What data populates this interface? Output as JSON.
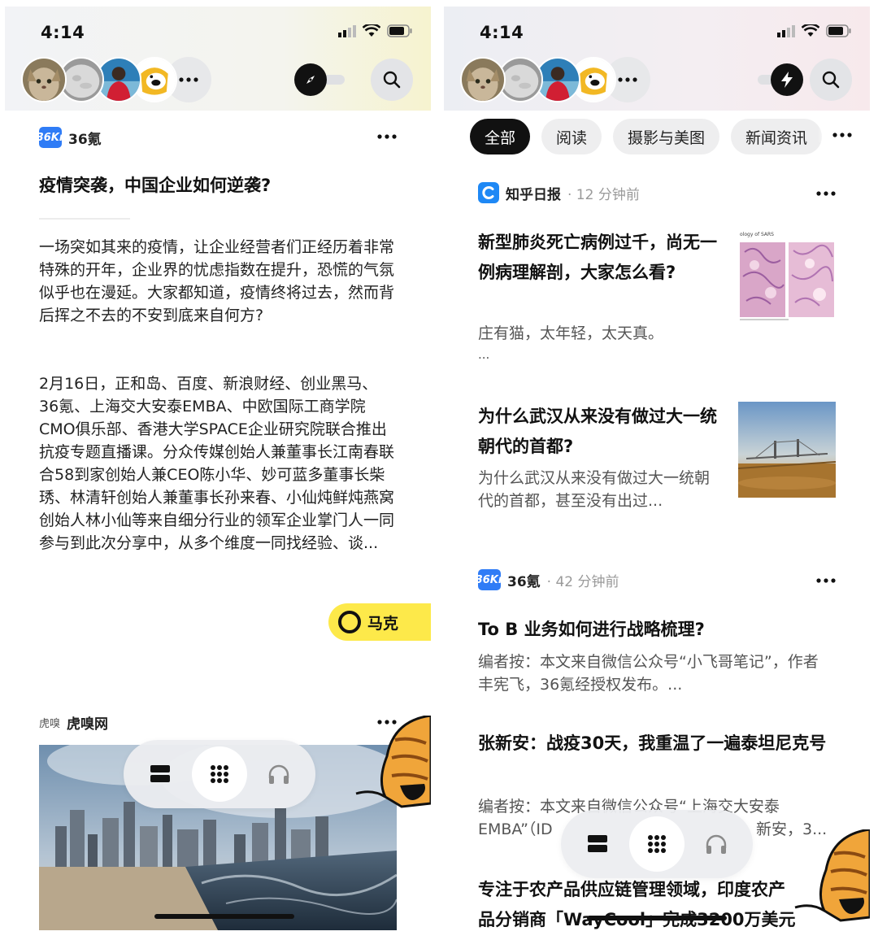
{
  "status_bar": {
    "time": "4:14"
  },
  "left": {
    "article": {
      "source": "36氪",
      "logo_text": "36Kr",
      "title": "疫情突袭，中国企业如何逆袭?",
      "paragraph_1": "一场突如其来的疫情，让企业经营者们正经历着非常特殊的开年，企业界的忧虑指数在提升，恐慌的气氛似乎也在漫延。大家都知道，疫情终将过去，然而背后挥之不去的不安到底来自何方?",
      "paragraph_2": "2月16日，正和岛、百度、新浪财经、创业黑马、36氪、上海交大安泰EMBA、中欧国际工商学院CMO俱乐部、香港大学SPACE企业研究院联合推出抗疫专题直播课。分众传媒创始人兼董事长江南春联合58到家创始人兼CEO陈小华、妙可蓝多董事长柴琇、林清轩创始人兼董事长孙来春、小仙炖鲜炖燕窝创始人林小仙等来自细分行业的领军企业掌门人一同参与到此次分享中，从多个维度一同找经验、谈..."
    },
    "marker_button": "马克",
    "second_source": {
      "logo_text": "虎嗅",
      "name": "虎嗅网"
    }
  },
  "right": {
    "tabs": [
      "全部",
      "阅读",
      "摄影与美图",
      "新闻资讯"
    ],
    "feed": [
      {
        "source": "知乎日报",
        "time": "· 12 分钟前",
        "title": "新型肺炎死亡病例过千，尚无一例病理解剖，大家怎么看?",
        "summary": "庄有猫，太年轻，太天真。",
        "summary_extra": "...",
        "thumb_caption": "ology of SARS"
      },
      {
        "title": "为什么武汉从来没有做过大一统朝代的首都?",
        "summary": "为什么武汉从来没有做过大一统朝代的首都，甚至没有出过..."
      },
      {
        "source": "36氪",
        "logo_text": "36Kr",
        "time": "· 42 分钟前",
        "title": "To B 业务如何进行战略梳理?",
        "summary": "编者按：本文来自微信公众号“小飞哥笔记”，作者丰宪飞，36氪经授权发布。..."
      },
      {
        "title": "张新安：战疫30天，我重温了一遍泰坦尼克号",
        "summary_line1": "编者按：本文来自微信公众号“上海交大安泰",
        "summary_line2_a": "EMBA”（ID",
        "summary_line2_b": "新安，3..."
      },
      {
        "title_line1": "专注于农产品供应链管理领域，印度农产",
        "title_line2": "品分销商「WayCool」完成3200万美元"
      }
    ]
  },
  "colors": {
    "accent_yellow": "#fde94a",
    "logo_36kr": "#2f7cf6",
    "zhihu_blue": "#1e88f5",
    "active_tab": "#111111"
  },
  "icons": [
    "wifi-icon",
    "battery-icon",
    "signal-icon",
    "compass-icon",
    "lightning-icon",
    "search-icon",
    "more-icon",
    "card-view-icon",
    "grid-view-icon",
    "headphones-icon"
  ]
}
